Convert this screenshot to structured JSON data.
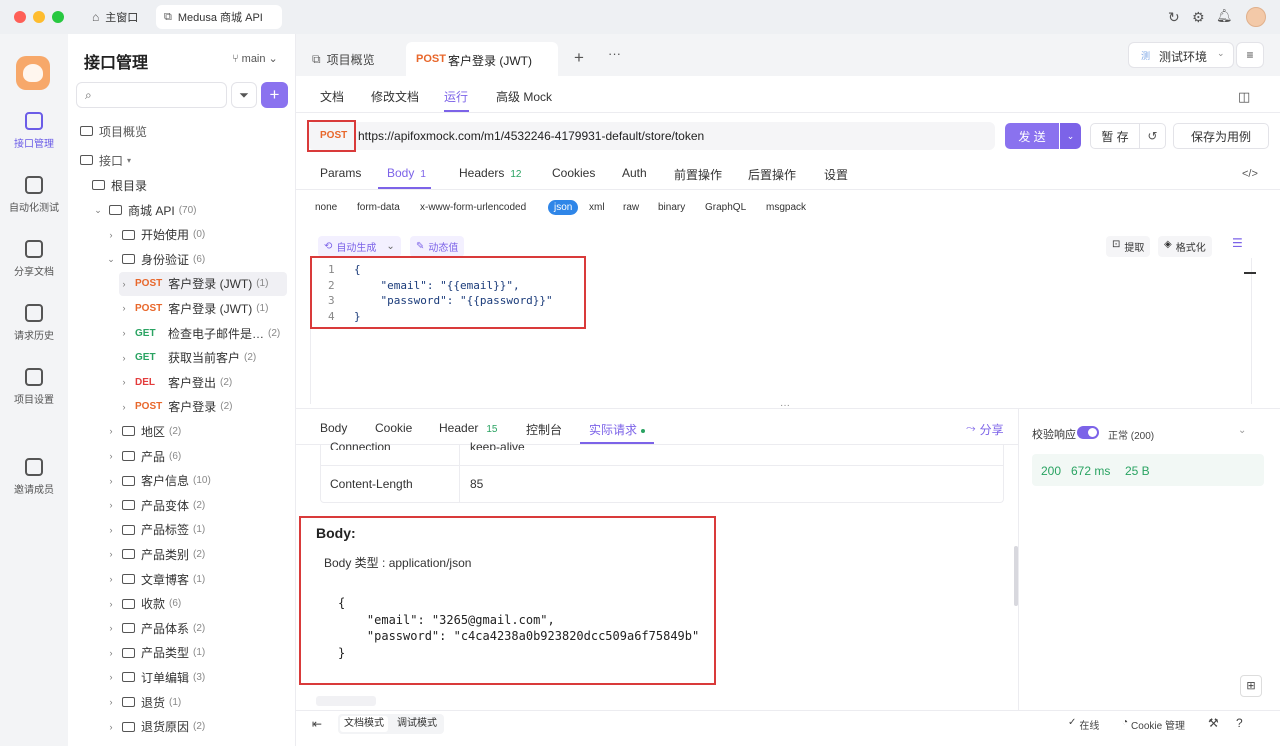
{
  "titlebar": {
    "home": "主窗口",
    "tab": "Medusa 商城 API"
  },
  "rail": [
    {
      "label": "接口管理",
      "active": true
    },
    {
      "label": "自动化测试"
    },
    {
      "label": "分享文档"
    },
    {
      "label": "请求历史"
    },
    {
      "label": "项目设置"
    },
    {
      "label": "邀请成员"
    }
  ],
  "tree": {
    "title": "接口管理",
    "branch": "main",
    "overview": "项目概览",
    "iface": "接口",
    "root": "根目录",
    "rows": [
      {
        "t": "folder",
        "label": "商城 API",
        "count": "(70)",
        "indent": 1,
        "open": true
      },
      {
        "t": "folder",
        "label": "开始使用",
        "count": "(0)",
        "indent": 2
      },
      {
        "t": "folder",
        "label": "身份验证",
        "count": "(6)",
        "indent": 2,
        "open": true
      },
      {
        "t": "api",
        "m": "POST",
        "label": "客户登录 (JWT)",
        "count": "(1)",
        "indent": 3,
        "active": true
      },
      {
        "t": "api",
        "m": "POST",
        "label": "客户登录 (JWT)",
        "count": "(1)",
        "indent": 3
      },
      {
        "t": "api",
        "m": "GET",
        "label": "检查电子邮件是…",
        "count": "(2)",
        "indent": 3
      },
      {
        "t": "api",
        "m": "GET",
        "label": "获取当前客户",
        "count": "(2)",
        "indent": 3
      },
      {
        "t": "api",
        "m": "DEL",
        "label": "客户登出",
        "count": "(2)",
        "indent": 3
      },
      {
        "t": "api",
        "m": "POST",
        "label": "客户登录",
        "count": "(2)",
        "indent": 3
      },
      {
        "t": "folder",
        "label": "地区",
        "count": "(2)",
        "indent": 2
      },
      {
        "t": "folder",
        "label": "产品",
        "count": "(6)",
        "indent": 2
      },
      {
        "t": "folder",
        "label": "客户信息",
        "count": "(10)",
        "indent": 2
      },
      {
        "t": "folder",
        "label": "产品变体",
        "count": "(2)",
        "indent": 2
      },
      {
        "t": "folder",
        "label": "产品标签",
        "count": "(1)",
        "indent": 2
      },
      {
        "t": "folder",
        "label": "产品类别",
        "count": "(2)",
        "indent": 2
      },
      {
        "t": "folder",
        "label": "文章博客",
        "count": "(1)",
        "indent": 2
      },
      {
        "t": "folder",
        "label": "收款",
        "count": "(6)",
        "indent": 2
      },
      {
        "t": "folder",
        "label": "产品体系",
        "count": "(2)",
        "indent": 2
      },
      {
        "t": "folder",
        "label": "产品类型",
        "count": "(1)",
        "indent": 2
      },
      {
        "t": "folder",
        "label": "订单编辑",
        "count": "(3)",
        "indent": 2
      },
      {
        "t": "folder",
        "label": "退货",
        "count": "(1)",
        "indent": 2
      },
      {
        "t": "folder",
        "label": "退货原因",
        "count": "(2)",
        "indent": 2
      }
    ]
  },
  "tabs": {
    "overview": "项目概览",
    "current_method": "POST",
    "current": "客户登录 (JWT)",
    "env": "测试环境",
    "env_badge": "测"
  },
  "subtabs": [
    "文档",
    "修改文档",
    "运行",
    "高级 Mock"
  ],
  "request": {
    "method": "POST",
    "url": "https://apifoxmock.com/m1/4532246-4179931-default/store/token",
    "send": "发 送",
    "save": "暂 存",
    "save_case": "保存为用例"
  },
  "reqtabs": [
    {
      "label": "Params"
    },
    {
      "label": "Body",
      "badge": "1",
      "active": true
    },
    {
      "label": "Headers",
      "badge": "12"
    },
    {
      "label": "Cookies"
    },
    {
      "label": "Auth"
    },
    {
      "label": "前置操作"
    },
    {
      "label": "后置操作"
    },
    {
      "label": "设置"
    }
  ],
  "bodytypes": [
    "none",
    "form-data",
    "x-www-form-urlencoded",
    "json",
    "xml",
    "raw",
    "binary",
    "GraphQL",
    "msgpack"
  ],
  "editor": {
    "auto": "自动生成",
    "dynamic": "动态值",
    "extract": "提取",
    "format": "格式化",
    "lines": [
      "{",
      "    \"email\": \"{{email}}\",",
      "    \"password\": \"{{password}}\"",
      "}"
    ]
  },
  "resptabs": [
    {
      "label": "Body"
    },
    {
      "label": "Cookie"
    },
    {
      "label": "Header",
      "badge": "15"
    },
    {
      "label": "控制台"
    },
    {
      "label": "实际请求",
      "active": true
    }
  ],
  "share": "分享",
  "headers_table": [
    {
      "k": "Connection",
      "v": "keep-alive"
    },
    {
      "k": "Content-Length",
      "v": "85"
    }
  ],
  "actual": {
    "title": "Body:",
    "type": "Body 类型 : application/json",
    "lines": [
      "{",
      "    \"email\": \"3265@gmail.com\",",
      "    \"password\": \"c4ca4238a0b923820dcc509a6f75849b\"",
      "}"
    ]
  },
  "verify": {
    "label": "校验响应",
    "status": "正常 (200)",
    "code": "200",
    "time": "672 ms",
    "size": "25 B"
  },
  "footer": {
    "doc_mode": "文档模式",
    "debug_mode": "调试模式",
    "online": "在线",
    "cookie": "Cookie 管理"
  }
}
